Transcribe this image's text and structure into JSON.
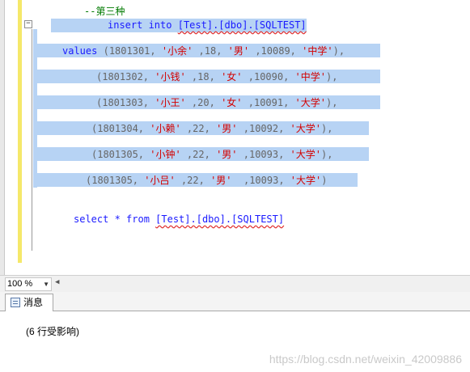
{
  "editor": {
    "comment": "--第三种",
    "insert_kw": "insert into",
    "insert_target": "[Test].[dbo].[SQLTEST]",
    "values_kw": "values",
    "rows": [
      {
        "prefix": "(1801301, ",
        "name": "'小余'",
        "mid1": " ,18, ",
        "sex": "'男'",
        "mid2": " ,10089, ",
        "edu": "'中学'",
        "end": "),"
      },
      {
        "prefix": "(1801302, ",
        "name": "'小钱'",
        "mid1": " ,18, ",
        "sex": "'女'",
        "mid2": " ,10090, ",
        "edu": "'中学'",
        "end": "),"
      },
      {
        "prefix": "(1801303, ",
        "name": "'小王'",
        "mid1": " ,20, ",
        "sex": "'女'",
        "mid2": " ,10091, ",
        "edu": "'大学'",
        "end": "),"
      },
      {
        "prefix": "(1801304, ",
        "name": "'小赖'",
        "mid1": " ,22, ",
        "sex": "'男'",
        "mid2": " ,10092, ",
        "edu": "'大学'",
        "end": "),"
      },
      {
        "prefix": "(1801305, ",
        "name": "'小钟'",
        "mid1": " ,22, ",
        "sex": "'男'",
        "mid2": " ,10093, ",
        "edu": "'大学'",
        "end": "),"
      },
      {
        "prefix": "(1801305, ",
        "name": "'小吕'",
        "mid1": " ,22, ",
        "sex": "'男'",
        "mid2": "  ,10093, ",
        "edu": "'大学'",
        "end": ")"
      }
    ],
    "select_kw": "select * from",
    "select_target": "[Test].[dbo].[SQLTEST]"
  },
  "zoom": {
    "value": "100 %"
  },
  "tabs": [
    {
      "label": "消息"
    }
  ],
  "messages": {
    "text": "(6 行受影响)"
  },
  "watermark": "https://blog.csdn.net/weixin_42009886",
  "colors": {
    "selection": "#b7d3f4",
    "keyword": "#1a1aff",
    "string": "#d40000",
    "comment": "#007a00"
  }
}
